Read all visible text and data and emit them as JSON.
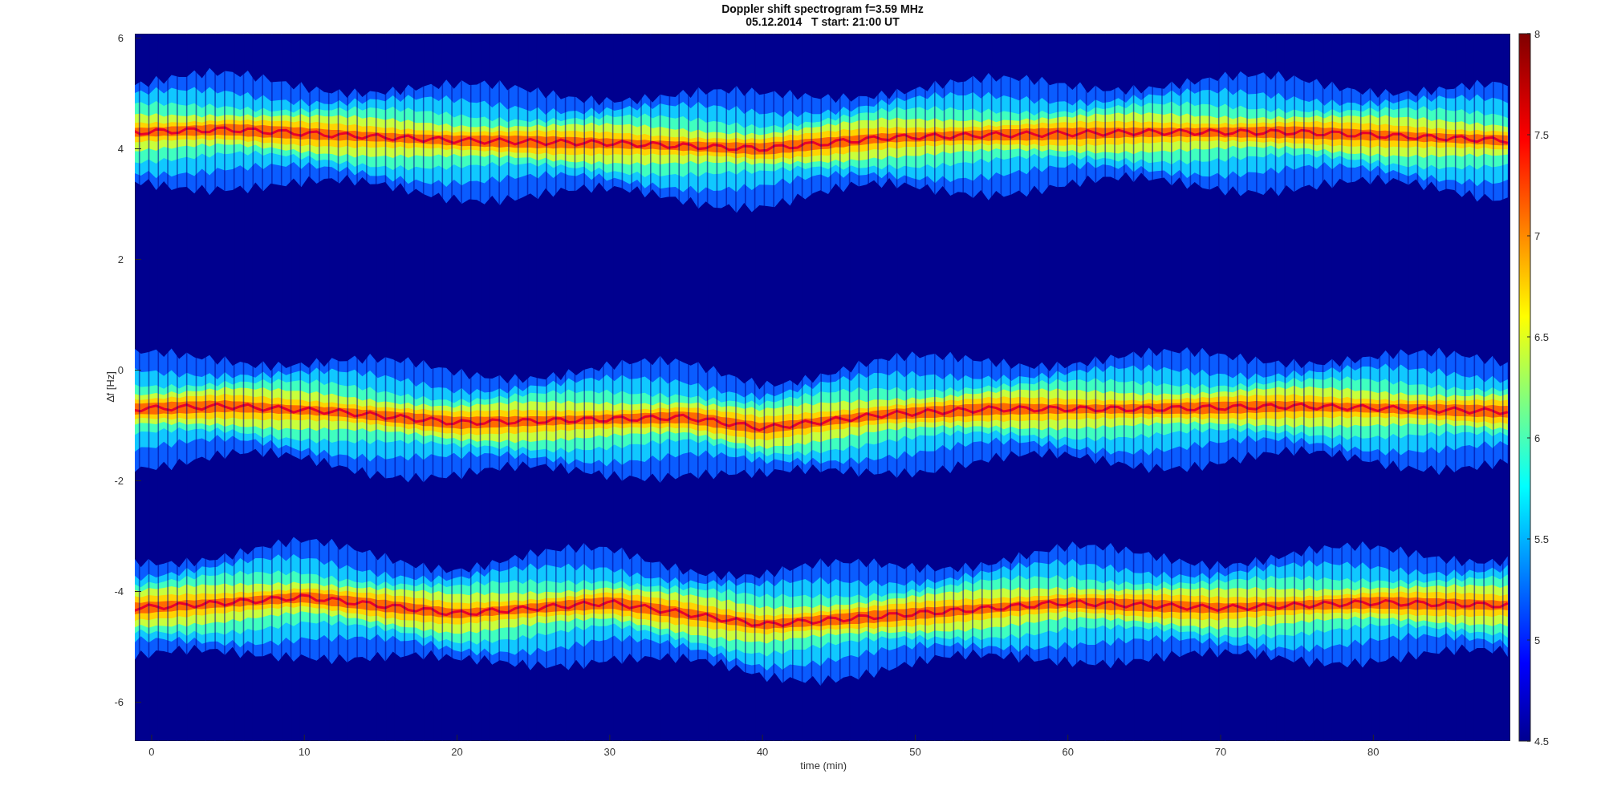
{
  "title": {
    "line_1": "Doppler shift spectrogram f=3.59 MHz",
    "line_2": "05.12.2014   T start: 21:00 UT"
  },
  "plot": {
    "ylabel": "∆f [Hz]",
    "xlabel": "time (min)",
    "xticks": [
      "0",
      "10",
      "20",
      "30",
      "40",
      "50",
      "60",
      "70",
      "80"
    ],
    "yticks": [
      "6",
      "4",
      "2",
      "0",
      "-2",
      "-4",
      "-6"
    ]
  },
  "colorbar": {
    "ticks": [
      "8",
      "7.5",
      "7",
      "6.5",
      "6",
      "5.5",
      "5",
      "4.5"
    ]
  }
}
